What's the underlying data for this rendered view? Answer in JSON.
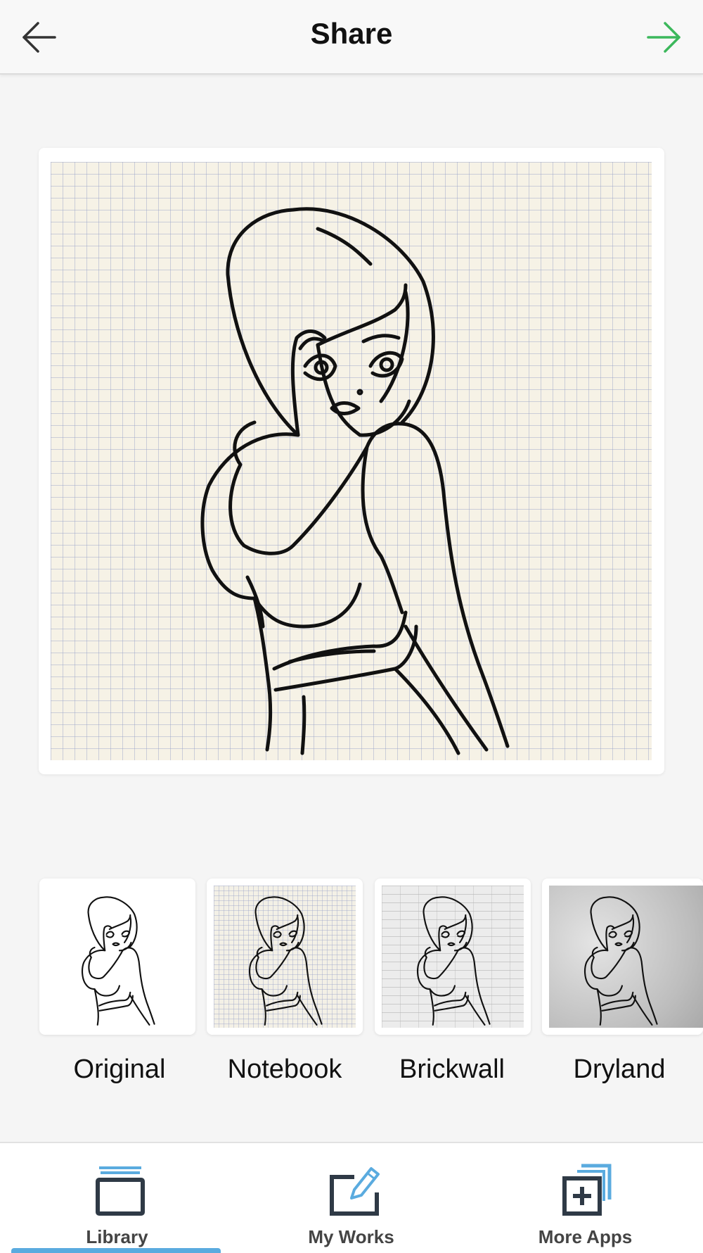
{
  "header": {
    "title": "Share",
    "back_icon": "arrow-left-icon",
    "next_icon": "arrow-right-icon",
    "next_color": "#3cb85c"
  },
  "preview": {
    "texture": "notebook"
  },
  "filters": [
    {
      "label": "Original",
      "texture": "original"
    },
    {
      "label": "Notebook",
      "texture": "notebook"
    },
    {
      "label": "Brickwall",
      "texture": "brickwall"
    },
    {
      "label": "Dryland",
      "texture": "dryland"
    }
  ],
  "tabbar": {
    "tabs": [
      {
        "label": "Library",
        "icon": "library-icon",
        "active": true
      },
      {
        "label": "My Works",
        "icon": "edit-icon",
        "active": false
      },
      {
        "label": "More Apps",
        "icon": "add-apps-icon",
        "active": false
      }
    ],
    "accent_color": "#5aabdf"
  }
}
